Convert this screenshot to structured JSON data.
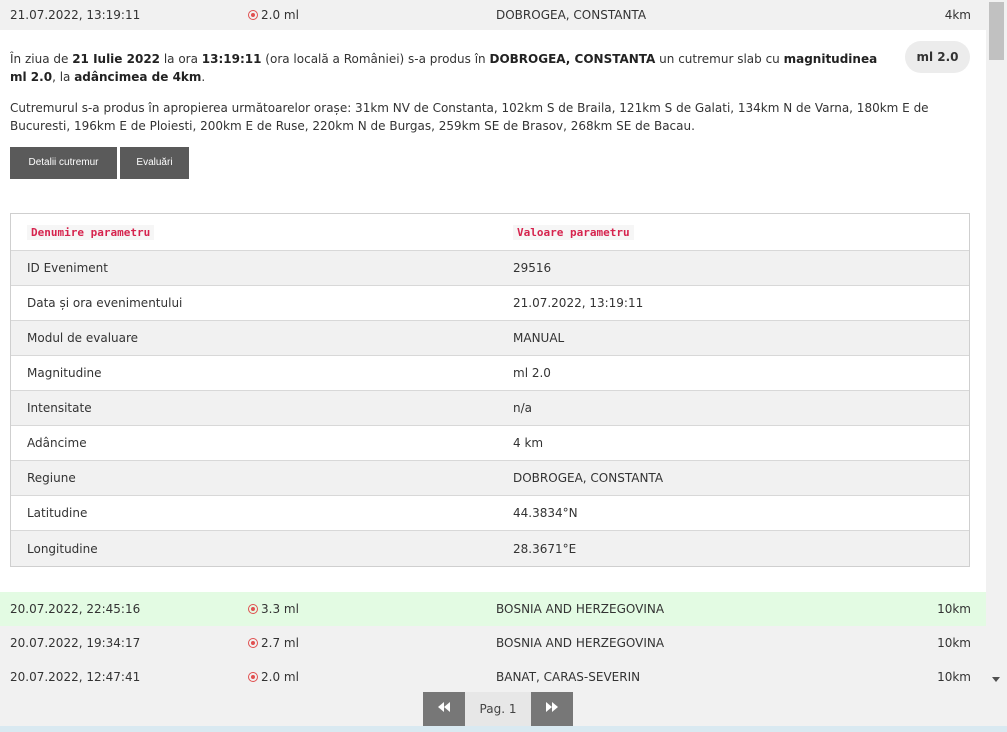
{
  "events": {
    "top": {
      "time": "21.07.2022, 13:19:11",
      "mag": "2.0 ml",
      "region": "DOBROGEA, CONSTANTA",
      "depth": "4km"
    },
    "list": [
      {
        "time": "20.07.2022, 22:45:16",
        "mag": "3.3 ml",
        "region": "BOSNIA AND HERZEGOVINA",
        "depth": "10km"
      },
      {
        "time": "20.07.2022, 19:34:17",
        "mag": "2.7 ml",
        "region": "BOSNIA AND HERZEGOVINA",
        "depth": "10km"
      },
      {
        "time": "20.07.2022, 12:47:41",
        "mag": "2.0 ml",
        "region": "BANAT, CARAS-SEVERIN",
        "depth": "10km"
      }
    ]
  },
  "details": {
    "desc": {
      "p1": "În ziua de ",
      "date": "21 Iulie 2022",
      "p2": " la ora ",
      "time": "13:19:11",
      "p3": " (ora locală a României) s-a produs în ",
      "region": "DOBROGEA, CONSTANTA",
      "p4": " un cutremur slab cu ",
      "mag": "magnitudinea ml 2.0",
      "p5": ", la ",
      "depth": "adâncimea de 4km",
      "p6": "."
    },
    "mag_badge": "ml 2.0",
    "cities": "Cutremurul s-a produs în apropierea următoarelor orașe: 31km NV de Constanta, 102km S de Braila, 121km S de Galati, 134km N de Varna, 180km E de Bucuresti, 196km E de Ploiesti, 200km E de Ruse, 220km N de Burgas, 259km SE de Brasov, 268km SE de Bacau.",
    "buttons": {
      "details": "Detalii cutremur",
      "evaluations": "Evaluări"
    },
    "table": {
      "head": [
        "Denumire parametru",
        "Valoare parametru"
      ],
      "rows": [
        [
          "ID Eveniment",
          "29516"
        ],
        [
          "Data și ora evenimentului",
          "21.07.2022, 13:19:11"
        ],
        [
          "Modul de evaluare",
          "MANUAL"
        ],
        [
          "Magnitudine",
          "ml 2.0"
        ],
        [
          "Intensitate",
          "n/a"
        ],
        [
          "Adâncime",
          "4 km"
        ],
        [
          "Regiune",
          "DOBROGEA, CONSTANTA"
        ],
        [
          "Latitudine",
          "44.3834°N"
        ],
        [
          "Longitudine",
          "28.3671°E"
        ]
      ]
    }
  },
  "pager": {
    "label": "Pag. 1",
    "prev_icon": "double-left-arrow",
    "next_icon": "double-right-arrow"
  },
  "colors": {
    "accent_red": "#e05050",
    "highlight_green": "#e3fbe3",
    "button_grey": "#5a5a5a",
    "code_red": "#d6244e"
  }
}
